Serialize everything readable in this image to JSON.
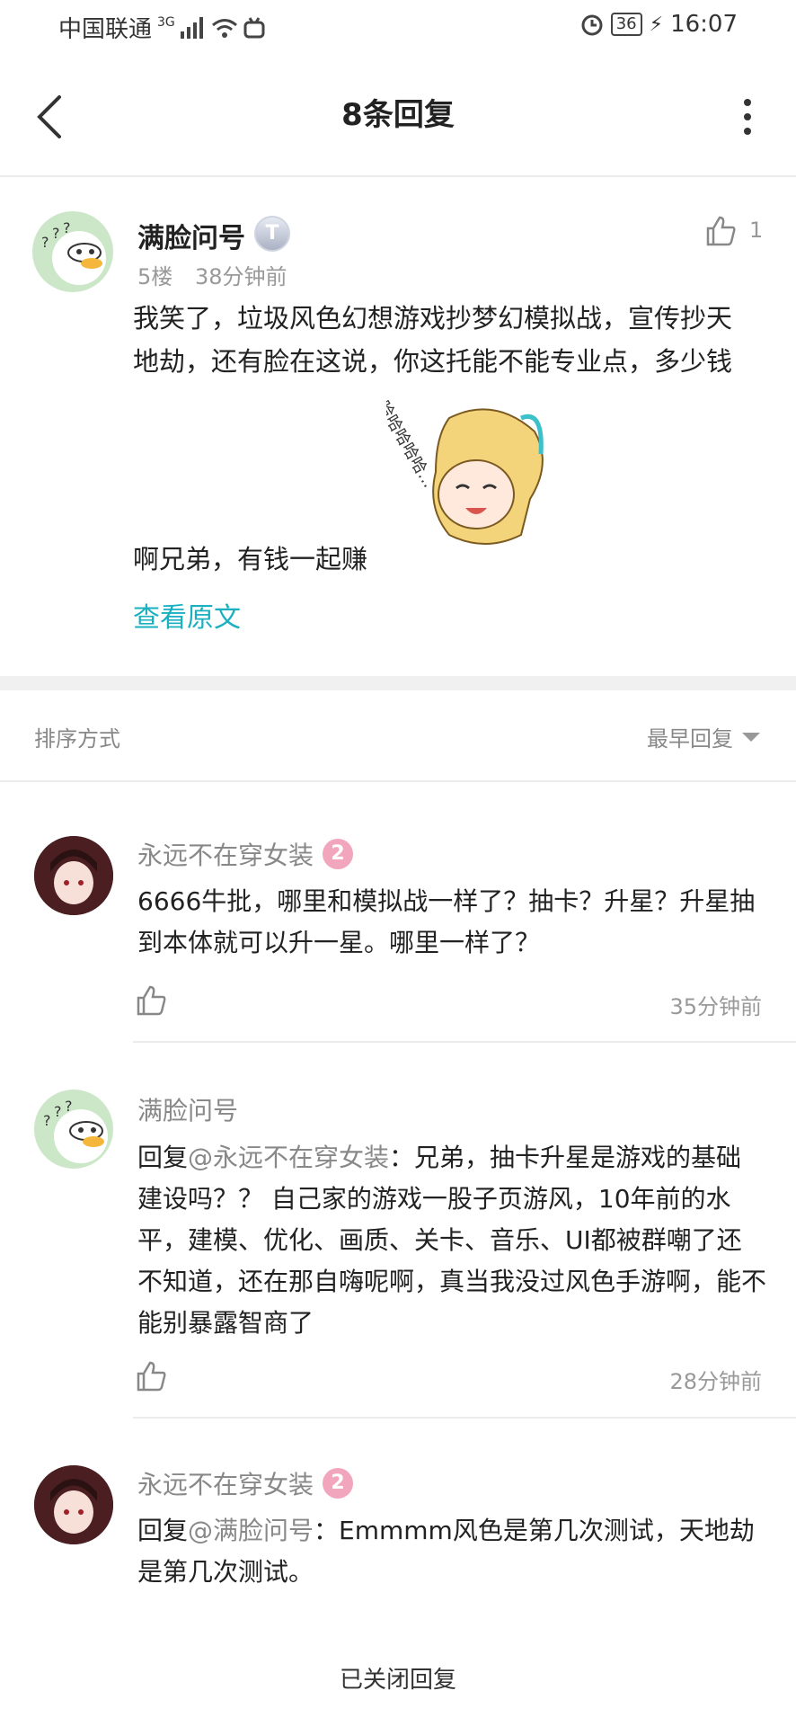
{
  "status_bar": {
    "carrier": "中国联通",
    "network": "3G",
    "battery": "36",
    "time": "16:07"
  },
  "header": {
    "title": "8条回复"
  },
  "post": {
    "user": "满脸问号",
    "badge": "T",
    "floor": "5楼",
    "time": "38分钟前",
    "likes": "1",
    "text_1": "我笑了，垃圾风色幻想游戏抄梦幻模拟战，宣传抄天地劫，还有脸在这说，你这托能不能专业点，多少钱",
    "text_2": "啊兄弟，有钱一起赚",
    "sticker_text": "哈哈哈哈哈…",
    "view_original": "查看原文"
  },
  "sort": {
    "label": "排序方式",
    "value": "最早回复"
  },
  "replies": [
    {
      "user": "永远不在穿女装",
      "level": "2",
      "mention": "",
      "text": "6666牛批，哪里和模拟战一样了？抽卡？升星？升星抽到本体就可以升一星。哪里一样了？",
      "time": "35分钟前"
    },
    {
      "user": "满脸问号",
      "level": "",
      "mention_prefix": "回复",
      "mention": "@永远不在穿女装",
      "text": "：兄弟，抽卡升星是游戏的基础建设吗？？ 自己家的游戏一股子页游风，10年前的水平，建模、优化、画质、关卡、音乐、UI都被群嘲了还不知道，还在那自嗨呢啊，真当我没过风色手游啊，能不能别暴露智商了",
      "time": "28分钟前"
    },
    {
      "user": "永远不在穿女装",
      "level": "2",
      "mention_prefix": "回复",
      "mention": "@满脸问号",
      "text": "：Emmmm风色是第几次测试，天地劫是第几次测试。",
      "time": ""
    }
  ],
  "footer": {
    "closed": "已关闭回复"
  }
}
